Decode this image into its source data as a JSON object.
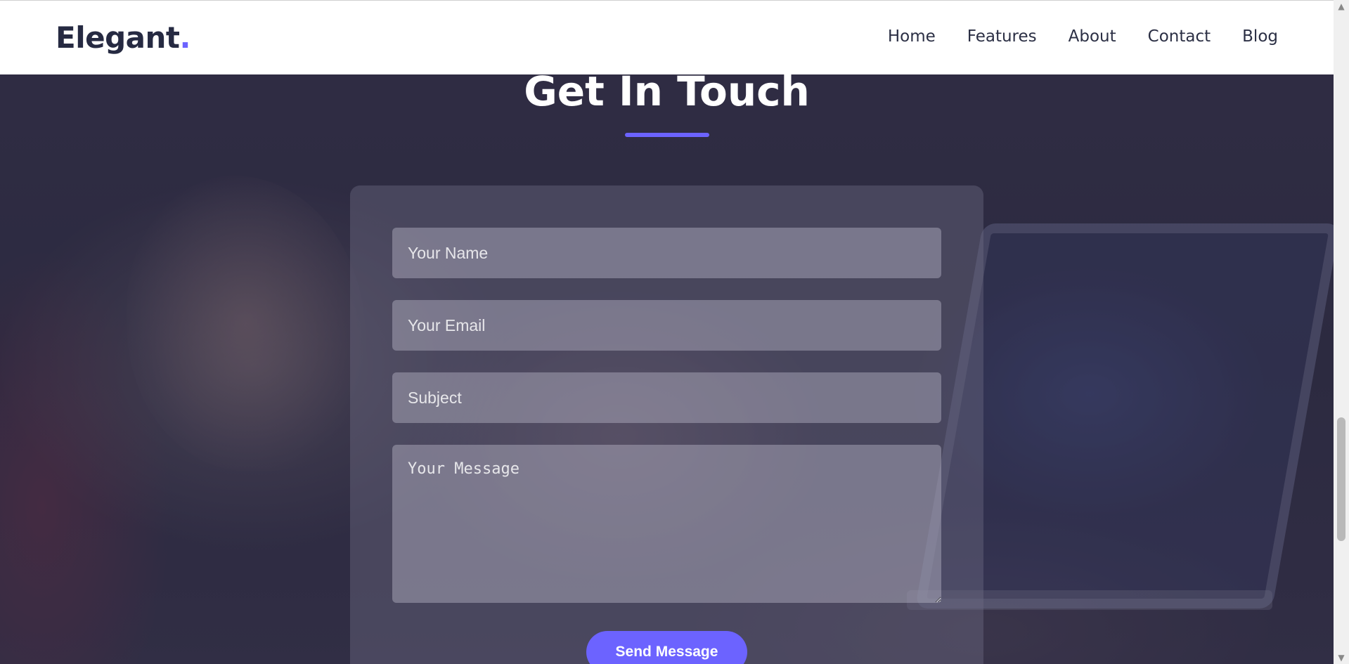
{
  "brand": {
    "name": "Elegant",
    "dot": ".",
    "accent_color": "#6c63ff"
  },
  "nav": {
    "links": [
      "Home",
      "Features",
      "About",
      "Contact",
      "Blog"
    ]
  },
  "contact": {
    "title": "Get In Touch",
    "fields": {
      "name_placeholder": "Your Name",
      "email_placeholder": "Your Email",
      "subject_placeholder": "Subject",
      "message_placeholder": "Your Message"
    },
    "submit_label": "Send Message"
  },
  "scrollbar": {
    "up_icon": "scroll-up-arrow-icon",
    "down_icon": "scroll-down-arrow-icon"
  }
}
